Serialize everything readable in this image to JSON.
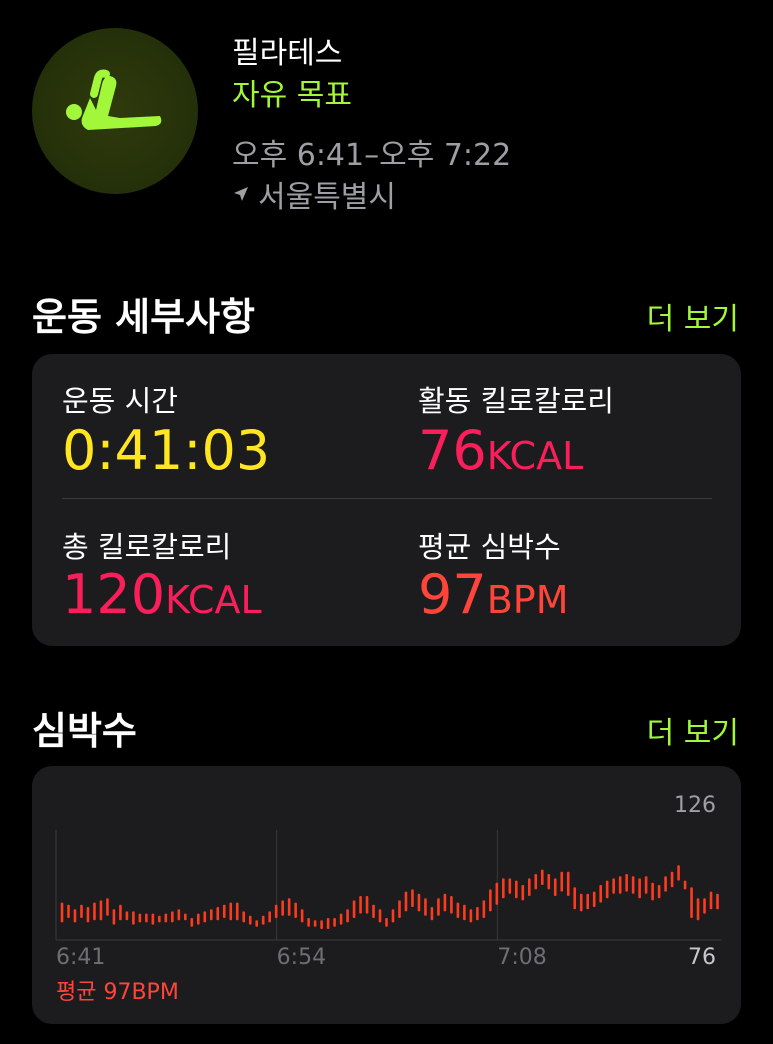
{
  "header": {
    "activity": "필라테스",
    "goal": "자유 목표",
    "time_range": "오후 6:41–오후 7:22",
    "location": "서울특별시",
    "icon": "pilates-figure-icon"
  },
  "details": {
    "section_title": "운동 세부사항",
    "more_label": "더 보기",
    "workout_time": {
      "label": "운동 시간",
      "value": "0:41:03"
    },
    "active_kcal": {
      "label": "활동 킬로칼로리",
      "value": "76",
      "unit": "KCAL"
    },
    "total_kcal": {
      "label": "총 킬로칼로리",
      "value": "120",
      "unit": "KCAL"
    },
    "avg_hr": {
      "label": "평균 심박수",
      "value": "97",
      "unit": "BPM"
    }
  },
  "heart_rate": {
    "section_title": "심박수",
    "more_label": "더 보기",
    "average": "평균 97BPM"
  },
  "colors": {
    "accent_green": "#a3f73b",
    "time_yellow": "#ffe620",
    "kcal_pink": "#fa1e5a",
    "bpm_red": "#ff453a",
    "card_bg": "#1c1c1e"
  },
  "chart_data": {
    "type": "bar",
    "title": "",
    "x_ticks": [
      "6:41",
      "6:54",
      "7:08"
    ],
    "ylim": [
      76,
      126
    ],
    "y_ticks": [
      126,
      76
    ],
    "series": [
      {
        "values": [
          [
            84,
            93
          ],
          [
            86,
            92
          ],
          [
            84,
            90
          ],
          [
            86,
            92
          ],
          [
            84,
            91
          ],
          [
            85,
            93
          ],
          [
            85,
            94
          ],
          [
            87,
            95
          ],
          [
            83,
            90
          ],
          [
            85,
            92
          ],
          [
            85,
            89
          ],
          [
            83,
            89
          ],
          [
            84,
            88
          ],
          [
            84,
            88
          ],
          [
            83,
            88
          ],
          [
            84,
            87
          ],
          [
            84,
            88
          ],
          [
            84,
            89
          ],
          [
            85,
            90
          ],
          [
            85,
            88
          ],
          [
            82,
            86
          ],
          [
            83,
            88
          ],
          [
            84,
            89
          ],
          [
            85,
            90
          ],
          [
            85,
            91
          ],
          [
            86,
            92
          ],
          [
            85,
            93
          ],
          [
            85,
            93
          ],
          [
            84,
            89
          ],
          [
            83,
            87
          ],
          [
            82,
            85
          ],
          [
            83,
            87
          ],
          [
            84,
            89
          ],
          [
            86,
            92
          ],
          [
            87,
            94
          ],
          [
            87,
            95
          ],
          [
            86,
            93
          ],
          [
            84,
            90
          ],
          [
            82,
            86
          ],
          [
            82,
            85
          ],
          [
            81,
            85
          ],
          [
            81,
            86
          ],
          [
            82,
            86
          ],
          [
            83,
            88
          ],
          [
            84,
            90
          ],
          [
            86,
            94
          ],
          [
            88,
            96
          ],
          [
            88,
            96
          ],
          [
            86,
            92
          ],
          [
            84,
            90
          ],
          [
            82,
            86
          ],
          [
            84,
            90
          ],
          [
            86,
            94
          ],
          [
            89,
            98
          ],
          [
            91,
            99
          ],
          [
            89,
            97
          ],
          [
            87,
            95
          ],
          [
            85,
            91
          ],
          [
            87,
            95
          ],
          [
            89,
            97
          ],
          [
            88,
            96
          ],
          [
            86,
            93
          ],
          [
            85,
            92
          ],
          [
            84,
            90
          ],
          [
            85,
            91
          ],
          [
            86,
            94
          ],
          [
            89,
            99
          ],
          [
            92,
            102
          ],
          [
            95,
            104
          ],
          [
            97,
            104
          ],
          [
            95,
            103
          ],
          [
            94,
            101
          ],
          [
            96,
            104
          ],
          [
            99,
            106
          ],
          [
            101,
            108
          ],
          [
            99,
            106
          ],
          [
            96,
            104
          ],
          [
            98,
            107
          ],
          [
            96,
            107
          ],
          [
            90,
            100
          ],
          [
            89,
            97
          ],
          [
            90,
            97
          ],
          [
            91,
            98
          ],
          [
            93,
            101
          ],
          [
            95,
            103
          ],
          [
            97,
            104
          ],
          [
            97,
            105
          ],
          [
            98,
            106
          ],
          [
            97,
            105
          ],
          [
            95,
            104
          ],
          [
            97,
            105
          ],
          [
            94,
            102
          ],
          [
            95,
            101
          ],
          [
            98,
            105
          ],
          [
            100,
            107
          ],
          [
            103,
            110
          ],
          [
            99,
            103
          ],
          [
            86,
            100
          ],
          [
            85,
            95
          ],
          [
            88,
            95
          ],
          [
            90,
            98
          ],
          [
            90,
            97
          ]
        ]
      }
    ],
    "grid": true
  }
}
